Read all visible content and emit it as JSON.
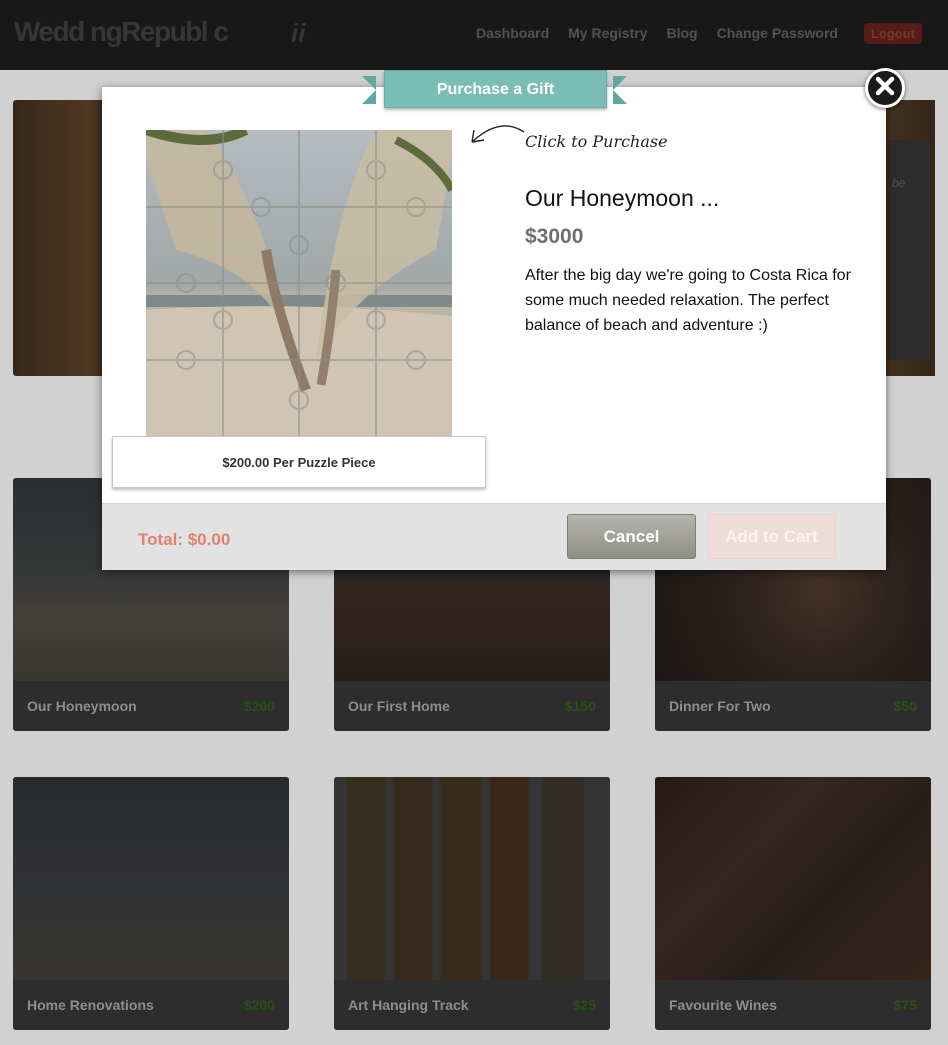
{
  "header": {
    "logo": "Wedd ngRepubl c",
    "logo_mark": "ii",
    "nav": [
      "Dashboard",
      "My Registry",
      "Blog",
      "Change Password"
    ],
    "logout": "Logout"
  },
  "background": {
    "hero_side_text": "be",
    "cards": [
      {
        "name": "Our Honeymoon",
        "price": "$200"
      },
      {
        "name": "Our First Home",
        "price": "$150"
      },
      {
        "name": "Dinner For Two",
        "price": "$50"
      },
      {
        "name": "Home Renovations",
        "price": "$200"
      },
      {
        "name": "Art Hanging Track",
        "price": "$25"
      },
      {
        "name": "Favourite Wines",
        "price": "$75"
      }
    ]
  },
  "modal": {
    "ribbon": "Purchase a Gift",
    "click_hint": "Click to Purchase",
    "gift_title": "Our Honeymoon ...",
    "gift_price": "$3000",
    "gift_description": "After the big day we're going to Costa Rica for some much needed relaxation. The perfect balance of beach and adventure :)",
    "piece_price": "$200.00 Per Puzzle Piece",
    "total": "Total: $0.00",
    "cancel": "Cancel",
    "add_to_cart": "Add to Cart"
  },
  "colors": {
    "ribbon": "#79bdb4",
    "total_text": "#e0826d",
    "price_green": "#2a5a1a"
  }
}
